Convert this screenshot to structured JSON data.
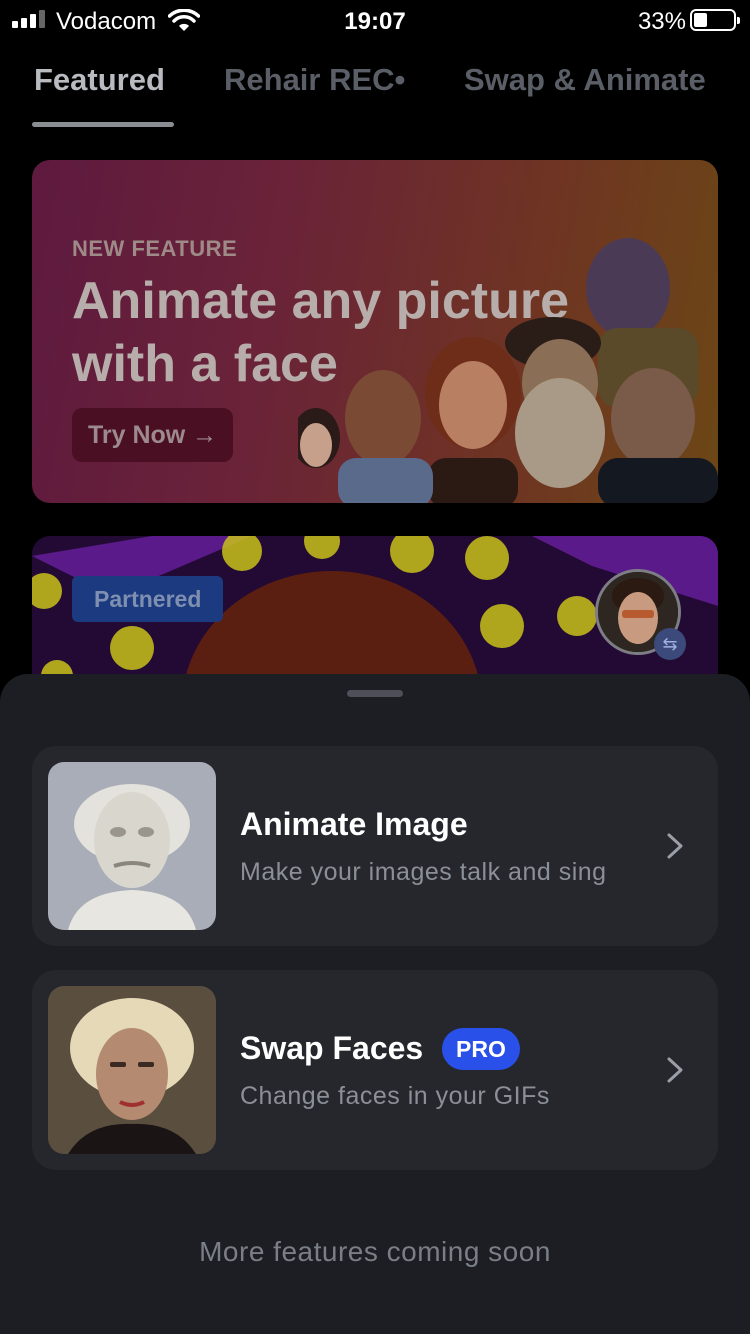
{
  "status_bar": {
    "carrier": "Vodacom",
    "time": "19:07",
    "battery_pct": "33%",
    "battery_level": 0.33,
    "signal_bars": 3
  },
  "tabs": [
    {
      "label": "Featured",
      "active": true
    },
    {
      "label": "Rehair REC•",
      "active": false
    },
    {
      "label": "Swap & Animate",
      "active": false
    }
  ],
  "banner": {
    "eyebrow": "NEW FEATURE",
    "title": "Animate any picture with a face",
    "cta": "Try Now →"
  },
  "partner_card": {
    "badge": "Partnered",
    "swap_icon": "swap-arrows-icon"
  },
  "sheet": {
    "items": [
      {
        "title": "Animate Image",
        "subtitle": "Make your images talk and sing",
        "icon": "chevron-right-icon"
      },
      {
        "title": "Swap Faces",
        "badge": "PRO",
        "subtitle": "Change faces in your GIFs",
        "icon": "chevron-right-icon"
      }
    ],
    "footer": "More features coming soon"
  },
  "colors": {
    "accent": "#2950e8",
    "sheet_bg": "#1c1e23",
    "card_bg": "#25272d"
  }
}
